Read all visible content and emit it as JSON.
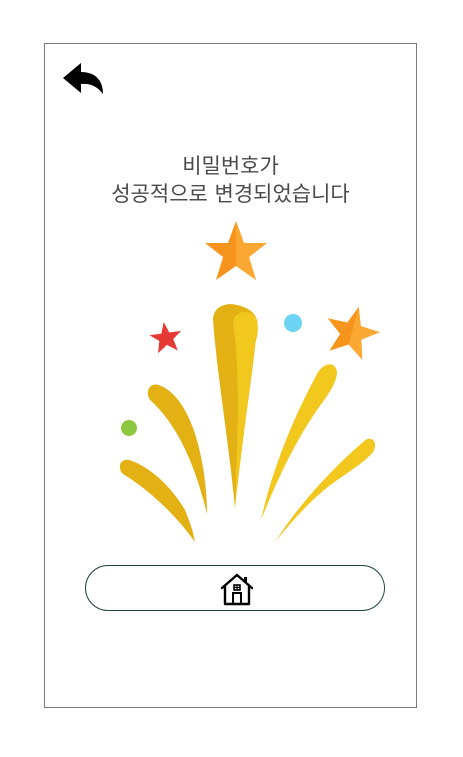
{
  "header": {
    "back_icon": "back-arrow-icon"
  },
  "message": {
    "line1": "비밀번호가",
    "line2": "성공적으로 변경되었습니다"
  },
  "illustration": {
    "icon": "fireworks-illustration",
    "colors": {
      "yellow": "#F2C81E",
      "yellow_dark": "#E3B114",
      "orange": "#F7941D",
      "orange_light": "#FBB03B",
      "red": "#E53935",
      "blue": "#6DD5F3",
      "green": "#8DC63F"
    }
  },
  "home_button": {
    "icon": "home-icon",
    "border_color": "#23473B"
  }
}
